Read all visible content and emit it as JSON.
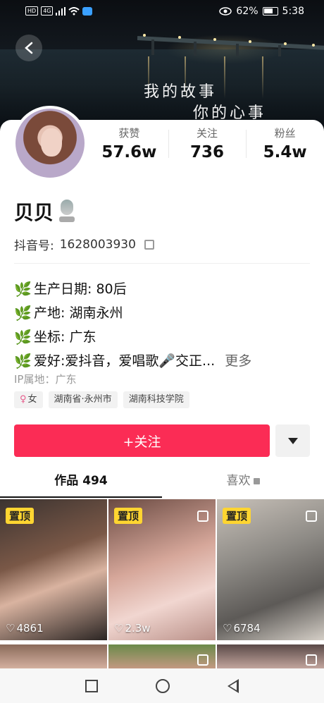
{
  "status_bar": {
    "hd": "HD",
    "network": "4G",
    "battery": "62%",
    "time": "5:38"
  },
  "cover": {
    "line1": "我的故事",
    "line2": "你的心事"
  },
  "profile": {
    "name": "贝贝",
    "douyin_id_label": "抖音号:",
    "douyin_id": "1628003930",
    "stats": [
      {
        "label": "获赞",
        "value": "57.6w"
      },
      {
        "label": "关注",
        "value": "736"
      },
      {
        "label": "粉丝",
        "value": "5.4w"
      }
    ],
    "bio": [
      {
        "icon": "🌿",
        "text": "生产日期: 80后"
      },
      {
        "icon": "🌿",
        "text": "产地: 湖南永州"
      },
      {
        "icon": "🌿",
        "text": "坐标: 广东"
      },
      {
        "icon": "🌿",
        "text": "爱好:爱抖音，爱唱歌🎤交正..."
      }
    ],
    "bio_more": "更多",
    "ip": "IP属地：广东",
    "tags": [
      "女",
      "湖南省·永州市",
      "湖南科技学院"
    ]
  },
  "actions": {
    "follow": "+关注"
  },
  "tabs": [
    {
      "label": "作品 494"
    },
    {
      "label": "喜欢"
    }
  ],
  "videos": [
    {
      "pinned": "置顶",
      "likes": "4861"
    },
    {
      "pinned": "置顶",
      "likes": "2.3w"
    },
    {
      "pinned": "置顶",
      "likes": "6784"
    }
  ],
  "colors": {
    "accent": "#fb2c55",
    "pin": "#ffd531"
  }
}
